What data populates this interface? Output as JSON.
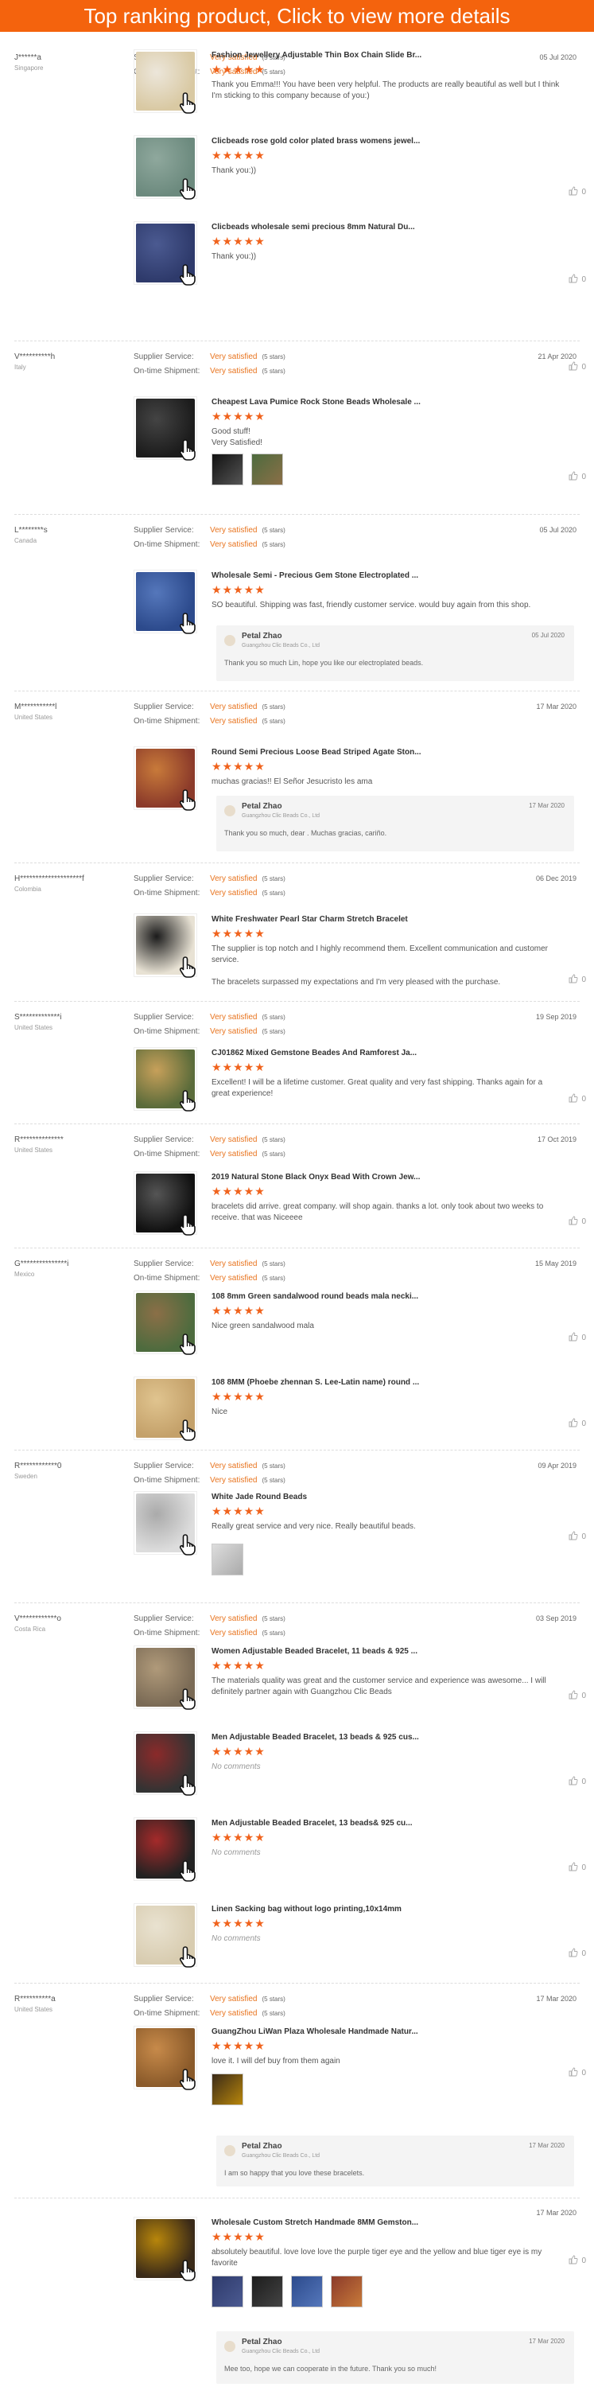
{
  "banner": "Top ranking product, Click to view more details",
  "labels": {
    "supplier": "Supplier Service:",
    "shipment": "On-time Shipment:",
    "very_satisfied": "Very satisfied",
    "five_stars": "(5 stars)",
    "rating_stars": "★★★★★",
    "no_comments": "No comments",
    "like_count": "0"
  },
  "colors": {
    "accent": "#f4630d",
    "star": "#f0631d"
  },
  "reviews": [
    {
      "buyer": "J******a",
      "country": "Singapore",
      "date": "05 Jul 2020",
      "items": [
        {
          "title": "Fashion Jewellery Adjustable Thin Box Chain Slide Br...",
          "comment": "Thank you Emma!!! You have been very helpful. The products are really beautiful as well but I think I'm sticking to this company because of you:)"
        },
        {
          "title": "Clicbeads rose gold color plated brass womens jewel...",
          "comment": "Thank you:))"
        },
        {
          "title": "Clicbeads wholesale semi precious 8mm Natural Du...",
          "comment": "Thank you:))"
        }
      ]
    },
    {
      "buyer": "V**********h",
      "country": "Italy",
      "date": "21 Apr 2020",
      "items": [
        {
          "title": "Cheapest Lava Pumice Rock Stone Beads Wholesale ...",
          "comment": "Good stuff!\nVery Satisfied!"
        }
      ]
    },
    {
      "buyer": "L********s",
      "country": "Canada",
      "date": "05 Jul 2020",
      "items": [
        {
          "title": "Wholesale Semi - Precious Gem Stone Electroplated ...",
          "comment": "SO beautiful. Shipping was fast, friendly customer service. would buy again from this shop."
        }
      ],
      "reply": {
        "name": "Petal Zhao",
        "company": "Guangzhou Clic Beads Co., Ltd",
        "date": "05 Jul 2020",
        "text": "Thank you so much Lin, hope you like our electroplated beads."
      }
    },
    {
      "buyer": "M***********l",
      "country": "United States",
      "date": "17 Mar 2020",
      "items": [
        {
          "title": "Round Semi Precious Loose Bead Striped Agate Ston...",
          "comment": "muchas gracias!! El Señor Jesucristo les ama"
        }
      ],
      "reply": {
        "name": "Petal Zhao",
        "company": "Guangzhou Clic Beads Co., Ltd",
        "date": "17 Mar 2020",
        "text": "Thank you so much, dear . Muchas gracias, cariño."
      }
    },
    {
      "buyer": "H********************f",
      "country": "Colombia",
      "date": "06 Dec 2019",
      "items": [
        {
          "title": "White Freshwater Pearl Star Charm Stretch Bracelet",
          "comment": "The supplier is top notch and I highly recommend them. Excellent communication and customer service.\n\nThe bracelets surpassed my expectations and I'm very pleased with the purchase."
        }
      ]
    },
    {
      "buyer": "S*************i",
      "country": "United States",
      "date": "19 Sep 2019",
      "items": [
        {
          "title": "CJ01862 Mixed Gemstone Beades And Ramforest Ja...",
          "comment": "Excellent! I will be a lifetime customer. Great quality and very fast shipping. Thanks again for a great experience!"
        }
      ]
    },
    {
      "buyer": "R**************",
      "country": "United States",
      "date": "17 Oct 2019",
      "items": [
        {
          "title": "2019 Natural Stone Black Onyx Bead With Crown Jew...",
          "comment": "bracelets did arrive.  great company. will shop again.  thanks a lot.      only took about two weeks to receive.  that was Niceeee"
        }
      ]
    },
    {
      "buyer": "G***************i",
      "country": "Mexico",
      "date": "15 May 2019",
      "items": [
        {
          "title": "108 8mm Green sandalwood round beads mala necki...",
          "comment": "Nice green sandalwood mala"
        },
        {
          "title": "108 8MM (Phoebe zhennan S. Lee-Latin name) round ...",
          "comment": "Nice"
        }
      ]
    },
    {
      "buyer": "R************0",
      "country": "Sweden",
      "date": "09 Apr 2019",
      "items": [
        {
          "title": "White Jade Round Beads",
          "comment": "Really great service and very nice. Really beautiful beads."
        }
      ]
    },
    {
      "buyer": "V************o",
      "country": "Costa Rica",
      "date": "03 Sep 2019",
      "items": [
        {
          "title": "Women Adjustable Beaded Bracelet, 11 beads & 925 ...",
          "comment": "The materials quality was great and the customer service and experience was awesome... I will definitely partner again with Guangzhou Clic Beads"
        },
        {
          "title": "Men Adjustable Beaded Bracelet, 13 beads & 925 cus...",
          "comment": ""
        },
        {
          "title": "Men Adjustable Beaded Bracelet,    13 beads& 925 cu...",
          "comment": ""
        },
        {
          "title": "Linen Sacking bag without logo printing,10x14mm",
          "comment": ""
        }
      ]
    },
    {
      "buyer": "R**********a",
      "country": "United States",
      "date": "17 Mar 2020",
      "items": [
        {
          "title": "GuangZhou LiWan Plaza Wholesale Handmade Natur...",
          "comment": "love it. I will def buy from them again"
        }
      ],
      "reply": {
        "name": "Petal Zhao",
        "company": "Guangzhou Clic Beads Co., Ltd",
        "date": "17 Mar 2020",
        "text": "I am so happy that you love these bracelets."
      }
    },
    {
      "buyer": "",
      "country": "",
      "date": "17 Mar 2020",
      "items": [
        {
          "title": "Wholesale Custom Stretch Handmade 8MM Gemston...",
          "comment": "absolutely beautiful. love love love the purple tiger eye and the yellow and blue tiger eye is my favorite"
        }
      ],
      "reply": {
        "name": "Petal Zhao",
        "company": "Guangzhou Clic Beads Co., Ltd",
        "date": "17 Mar 2020",
        "text": "Mee too, hope we can cooperate in the future. Thank you so much!"
      }
    }
  ]
}
